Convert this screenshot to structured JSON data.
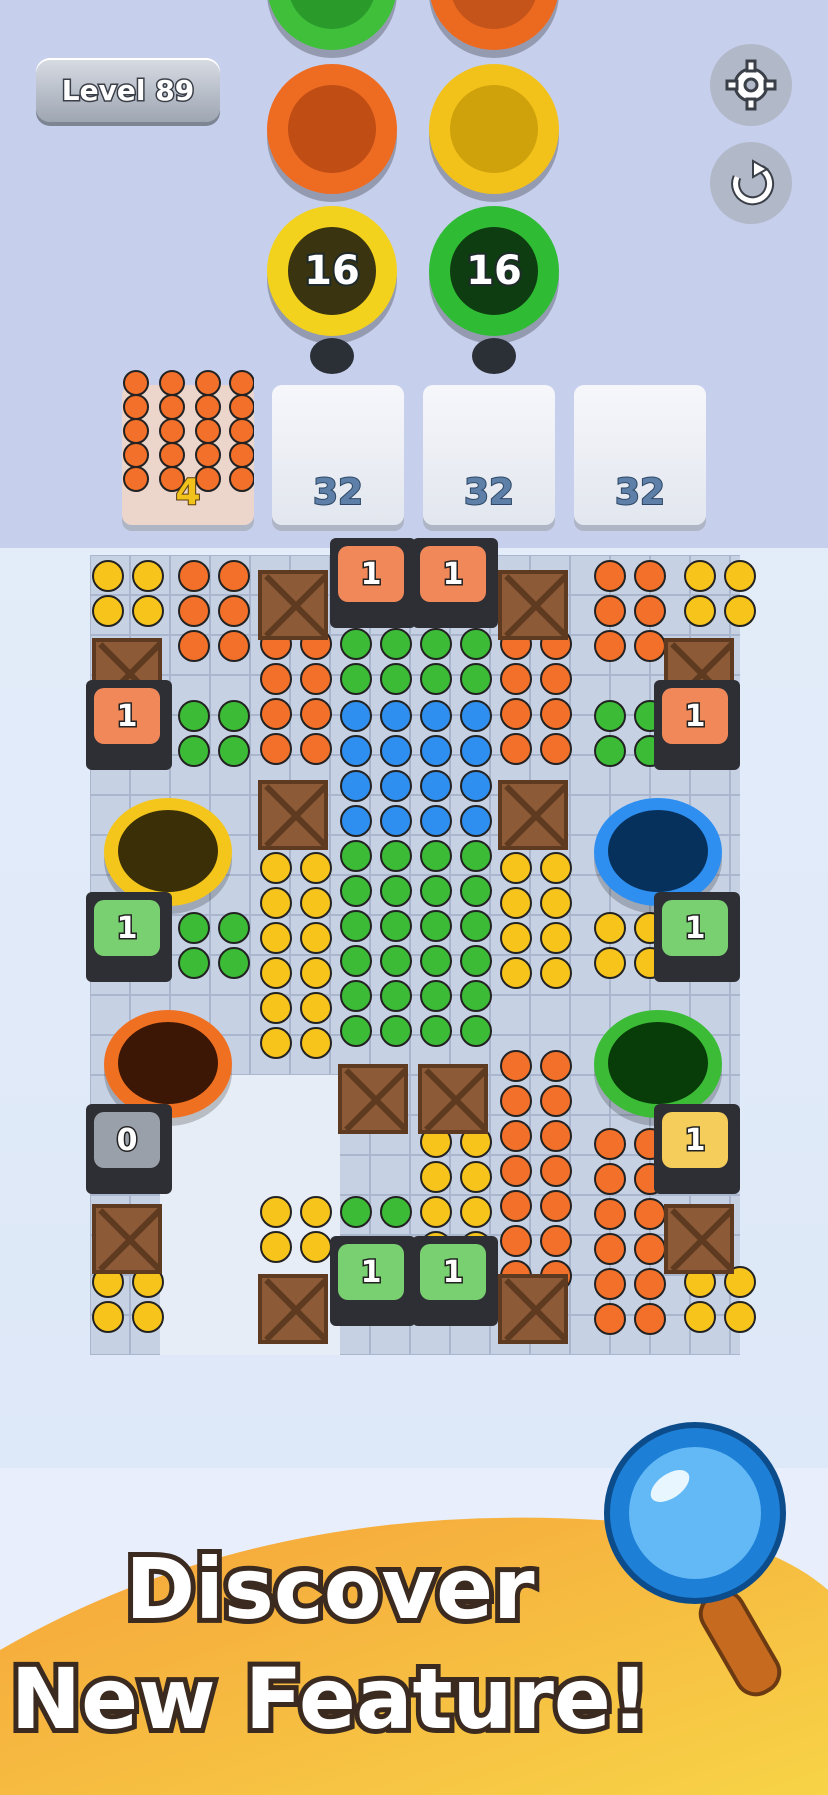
{
  "hud": {
    "level_label": "Level 89",
    "settings_icon": "gear-icon",
    "restart_icon": "restart-icon"
  },
  "queue": {
    "discs": [
      {
        "color": "#3fbf3a",
        "count": ""
      },
      {
        "color": "#ec6a1f",
        "count": ""
      },
      {
        "color": "#ee6b22",
        "count": ""
      },
      {
        "color": "#f2c21a",
        "count": ""
      },
      {
        "color": "#f2d21d",
        "count": "16"
      },
      {
        "color": "#2fbc34",
        "count": "16"
      }
    ]
  },
  "slots": {
    "filled_count": "4",
    "empty": [
      "32",
      "32",
      "32"
    ]
  },
  "board": {
    "gates": [
      "1",
      "1",
      "1",
      "1",
      "1",
      "1",
      "0",
      "1",
      "1",
      "1"
    ],
    "colors": {
      "yellow": "#f6c41b",
      "orange": "#f2702a",
      "green": "#3cbb37",
      "blue": "#2f8ff0"
    }
  },
  "promo": {
    "line1": "Discover",
    "line2": "New Feature!",
    "magnifier_icon": "magnifier-icon"
  }
}
